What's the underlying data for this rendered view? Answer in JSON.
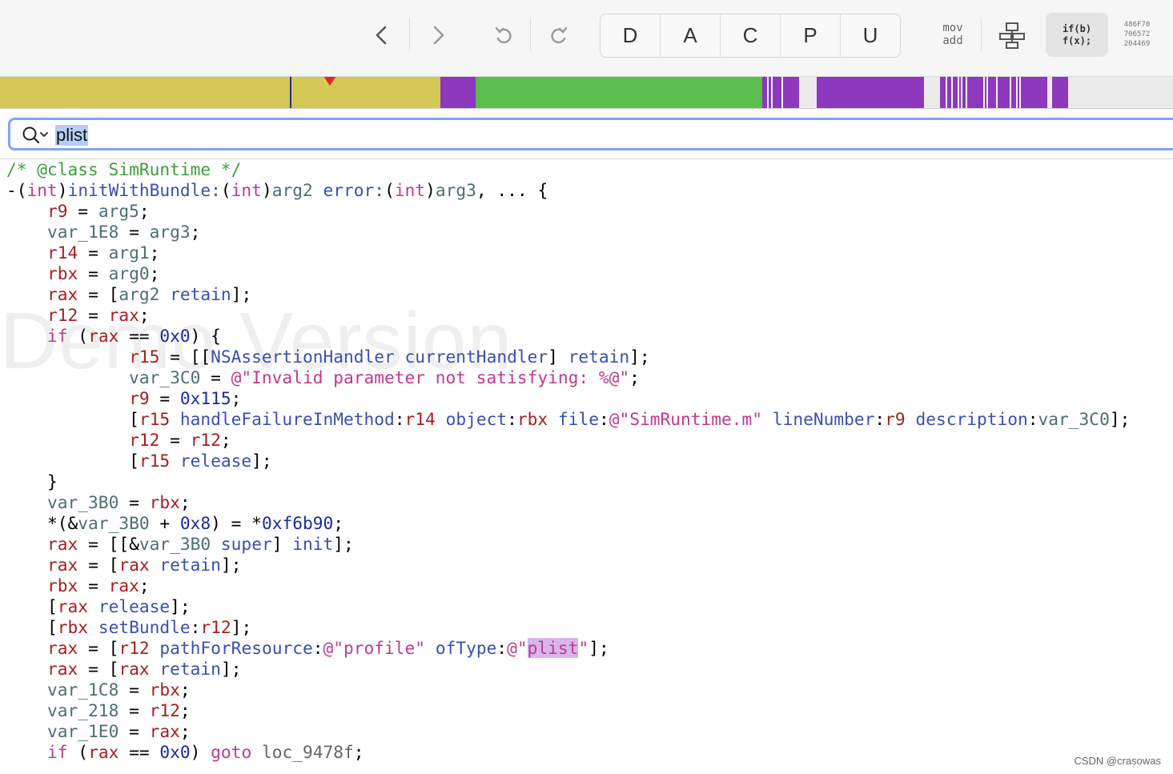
{
  "toolbar": {
    "nav_buttons": [
      "back",
      "forward",
      "undo",
      "redo"
    ],
    "segments": [
      "D",
      "A",
      "C",
      "P",
      "U"
    ],
    "asm_mode": {
      "line1": "mov",
      "line2": "add"
    },
    "pseudo_mode": {
      "line1": "if(b)",
      "line2": "f(x);"
    },
    "hex_mode": {
      "line1": "486F70",
      "line2": "706572",
      "line3": "204469"
    }
  },
  "navbar": {
    "segments": [
      {
        "color": "#d3c954",
        "from": 0,
        "to": 550
      },
      {
        "color": "#8d38bd",
        "from": 550,
        "to": 594
      },
      {
        "color": "#5bbd4e",
        "from": 594,
        "to": 952
      },
      {
        "color": "#8d38bd",
        "from": 952,
        "to": 998
      },
      {
        "color": "#ebebeb",
        "from": 998,
        "to": 1020
      },
      {
        "color": "#8d38bd",
        "from": 1020,
        "to": 1154
      },
      {
        "color": "#ebebeb",
        "from": 1154,
        "to": 1174
      },
      {
        "color": "#8d38bd",
        "from": 1174,
        "to": 1308
      },
      {
        "color": "#ebebeb",
        "from": 1308,
        "to": 1314
      },
      {
        "color": "#8d38bd",
        "from": 1314,
        "to": 1334
      },
      {
        "color": "#ebebeb",
        "from": 1334,
        "to": 1465
      }
    ],
    "gaps": [
      958,
      963,
      976,
      1181,
      1188,
      1196,
      1200,
      1206,
      1228,
      1232,
      1244,
      1261,
      1269,
      1273
    ]
  },
  "search": {
    "value": "plist"
  },
  "watermark": "Demo Version",
  "code": [
    [
      [
        "cm",
        "/* @class SimRuntime */"
      ]
    ],
    [
      [
        "",
        "-("
      ],
      [
        "tp",
        "int"
      ],
      [
        "",
        ")"
      ],
      [
        "msg",
        "initWithBundle:"
      ],
      [
        "",
        "("
      ],
      [
        "tp",
        "int"
      ],
      [
        "",
        ")"
      ],
      [
        "var",
        "arg2"
      ],
      [
        "",
        " "
      ],
      [
        "msg",
        "error:"
      ],
      [
        "",
        "("
      ],
      [
        "tp",
        "int"
      ],
      [
        "",
        ")"
      ],
      [
        "var",
        "arg3"
      ],
      [
        "",
        ", ... {"
      ]
    ],
    [
      [
        "",
        "    "
      ],
      [
        "reg",
        "r9"
      ],
      [
        "",
        " = "
      ],
      [
        "var",
        "arg5"
      ],
      [
        "",
        ";"
      ]
    ],
    [
      [
        "",
        "    "
      ],
      [
        "var",
        "var_1E8"
      ],
      [
        "",
        " = "
      ],
      [
        "var",
        "arg3"
      ],
      [
        "",
        ";"
      ]
    ],
    [
      [
        "",
        "    "
      ],
      [
        "reg",
        "r14"
      ],
      [
        "",
        " = "
      ],
      [
        "var",
        "arg1"
      ],
      [
        "",
        ";"
      ]
    ],
    [
      [
        "",
        "    "
      ],
      [
        "reg",
        "rbx"
      ],
      [
        "",
        " = "
      ],
      [
        "var",
        "arg0"
      ],
      [
        "",
        ";"
      ]
    ],
    [
      [
        "",
        "    "
      ],
      [
        "reg",
        "rax"
      ],
      [
        "",
        " = ["
      ],
      [
        "var",
        "arg2"
      ],
      [
        "",
        " "
      ],
      [
        "msg",
        "retain"
      ],
      [
        "",
        "];"
      ]
    ],
    [
      [
        "",
        "    "
      ],
      [
        "reg",
        "r12"
      ],
      [
        "",
        " = "
      ],
      [
        "reg",
        "rax"
      ],
      [
        "",
        ";"
      ]
    ],
    [
      [
        "",
        "    "
      ],
      [
        "kw",
        "if"
      ],
      [
        "",
        " ("
      ],
      [
        "reg",
        "rax"
      ],
      [
        "",
        " == "
      ],
      [
        "num",
        "0x0"
      ],
      [
        "",
        ") {"
      ]
    ],
    [
      [
        "",
        "            "
      ],
      [
        "reg",
        "r15"
      ],
      [
        "",
        " = [["
      ],
      [
        "cls",
        "NSAssertionHandler"
      ],
      [
        "",
        " "
      ],
      [
        "msg",
        "currentHandler"
      ],
      [
        "",
        "] "
      ],
      [
        "msg",
        "retain"
      ],
      [
        "",
        "];"
      ]
    ],
    [
      [
        "",
        "            "
      ],
      [
        "var",
        "var_3C0"
      ],
      [
        "",
        " = "
      ],
      [
        "str",
        "@\"Invalid parameter not satisfying: %@\""
      ],
      [
        "",
        ";"
      ]
    ],
    [
      [
        "",
        "            "
      ],
      [
        "reg",
        "r9"
      ],
      [
        "",
        " = "
      ],
      [
        "num",
        "0x115"
      ],
      [
        "",
        ";"
      ]
    ],
    [
      [
        "",
        "            ["
      ],
      [
        "reg",
        "r15"
      ],
      [
        "",
        " "
      ],
      [
        "msg",
        "handleFailureInMethod"
      ],
      [
        "",
        ":"
      ],
      [
        "reg",
        "r14"
      ],
      [
        "",
        " "
      ],
      [
        "msg",
        "object"
      ],
      [
        "",
        ":"
      ],
      [
        "reg",
        "rbx"
      ],
      [
        "",
        " "
      ],
      [
        "msg",
        "file"
      ],
      [
        "",
        ":"
      ],
      [
        "str",
        "@\"SimRuntime.m\""
      ],
      [
        "",
        " "
      ],
      [
        "msg",
        "lineNumber"
      ],
      [
        "",
        ":"
      ],
      [
        "reg",
        "r9"
      ],
      [
        "",
        " "
      ],
      [
        "msg",
        "description"
      ],
      [
        "",
        ":"
      ],
      [
        "var",
        "var_3C0"
      ],
      [
        "",
        "];"
      ]
    ],
    [
      [
        "",
        "            "
      ],
      [
        "reg",
        "r12"
      ],
      [
        "",
        " = "
      ],
      [
        "reg",
        "r12"
      ],
      [
        "",
        ";"
      ]
    ],
    [
      [
        "",
        "            ["
      ],
      [
        "reg",
        "r15"
      ],
      [
        "",
        " "
      ],
      [
        "msg",
        "release"
      ],
      [
        "",
        "];"
      ]
    ],
    [
      [
        "",
        "    }"
      ]
    ],
    [
      [
        "",
        "    "
      ],
      [
        "var",
        "var_3B0"
      ],
      [
        "",
        " = "
      ],
      [
        "reg",
        "rbx"
      ],
      [
        "",
        ";"
      ]
    ],
    [
      [
        "",
        "    *(&"
      ],
      [
        "var",
        "var_3B0"
      ],
      [
        "",
        " + "
      ],
      [
        "num",
        "0x8"
      ],
      [
        "",
        ") = *"
      ],
      [
        "num",
        "0xf6b90"
      ],
      [
        "",
        ";"
      ]
    ],
    [
      [
        "",
        "    "
      ],
      [
        "reg",
        "rax"
      ],
      [
        "",
        " = [[&"
      ],
      [
        "var",
        "var_3B0"
      ],
      [
        "",
        " "
      ],
      [
        "msg",
        "super"
      ],
      [
        "",
        "] "
      ],
      [
        "msg",
        "init"
      ],
      [
        "",
        "];"
      ]
    ],
    [
      [
        "",
        "    "
      ],
      [
        "reg",
        "rax"
      ],
      [
        "",
        " = ["
      ],
      [
        "reg",
        "rax"
      ],
      [
        "",
        " "
      ],
      [
        "msg",
        "retain"
      ],
      [
        "",
        "];"
      ]
    ],
    [
      [
        "",
        "    "
      ],
      [
        "reg",
        "rbx"
      ],
      [
        "",
        " = "
      ],
      [
        "reg",
        "rax"
      ],
      [
        "",
        ";"
      ]
    ],
    [
      [
        "",
        "    ["
      ],
      [
        "reg",
        "rax"
      ],
      [
        "",
        " "
      ],
      [
        "msg",
        "release"
      ],
      [
        "",
        "];"
      ]
    ],
    [
      [
        "",
        "    ["
      ],
      [
        "reg",
        "rbx"
      ],
      [
        "",
        " "
      ],
      [
        "msg",
        "setBundle"
      ],
      [
        "",
        ":"
      ],
      [
        "reg",
        "r12"
      ],
      [
        "",
        "];"
      ]
    ],
    [
      [
        "",
        "    "
      ],
      [
        "reg",
        "rax"
      ],
      [
        "",
        " = ["
      ],
      [
        "reg",
        "r12"
      ],
      [
        "",
        " "
      ],
      [
        "msg",
        "pathForResource"
      ],
      [
        "",
        ":"
      ],
      [
        "str",
        "@\"profile\""
      ],
      [
        "",
        " "
      ],
      [
        "msg",
        "ofType"
      ],
      [
        "",
        ":"
      ],
      [
        "str",
        "@\""
      ],
      [
        "hl",
        "plist"
      ],
      [
        "str",
        "\""
      ],
      [
        "",
        "];"
      ]
    ],
    [
      [
        "",
        "    "
      ],
      [
        "reg",
        "rax"
      ],
      [
        "",
        " = ["
      ],
      [
        "reg",
        "rax"
      ],
      [
        "",
        " "
      ],
      [
        "msg",
        "retain"
      ],
      [
        "",
        "];"
      ]
    ],
    [
      [
        "",
        "    "
      ],
      [
        "var",
        "var_1C8"
      ],
      [
        "",
        " = "
      ],
      [
        "reg",
        "rbx"
      ],
      [
        "",
        ";"
      ]
    ],
    [
      [
        "",
        "    "
      ],
      [
        "var",
        "var_218"
      ],
      [
        "",
        " = "
      ],
      [
        "reg",
        "r12"
      ],
      [
        "",
        ";"
      ]
    ],
    [
      [
        "",
        "    "
      ],
      [
        "var",
        "var_1E0"
      ],
      [
        "",
        " = "
      ],
      [
        "reg",
        "rax"
      ],
      [
        "",
        ";"
      ]
    ],
    [
      [
        "",
        "    "
      ],
      [
        "kw",
        "if"
      ],
      [
        "",
        " ("
      ],
      [
        "reg",
        "rax"
      ],
      [
        "",
        " == "
      ],
      [
        "num",
        "0x0"
      ],
      [
        "",
        ") "
      ],
      [
        "kw",
        "goto"
      ],
      [
        "",
        " "
      ],
      [
        "lbl",
        "loc_9478f"
      ],
      [
        "",
        ";"
      ]
    ]
  ],
  "footer": "CSDN @crasowas"
}
